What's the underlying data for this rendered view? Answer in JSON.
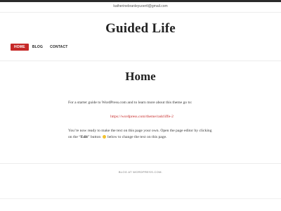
{
  "top_bar": {
    "email": "katherinebranleyuoertl@gmail.com"
  },
  "header": {
    "site_title": "Guided Life"
  },
  "nav": {
    "items": [
      {
        "label": "HOME",
        "active": true
      },
      {
        "label": "BLOG",
        "active": false
      },
      {
        "label": "CONTACT",
        "active": false
      }
    ]
  },
  "main": {
    "page_title": "Home",
    "intro_text": "For a starter guide to WordPress.com and to learn more about this theme go to:",
    "theme_link": "https://wordpress.com/theme/radcliffe-2",
    "body_text_before_edit": "You’re now ready to make the text on this page your own. Open the page editor by clicking on the “",
    "edit_label": "Edit",
    "body_text_after_edit": "” button ",
    "body_text_end": " below to change the text on this page."
  },
  "footer": {
    "credit": "BLOG AT WORDPRESS.COM."
  },
  "colors": {
    "accent": "#c62827",
    "nav_active_text": "#ffffff",
    "top_rule": "#2b2b2b"
  }
}
